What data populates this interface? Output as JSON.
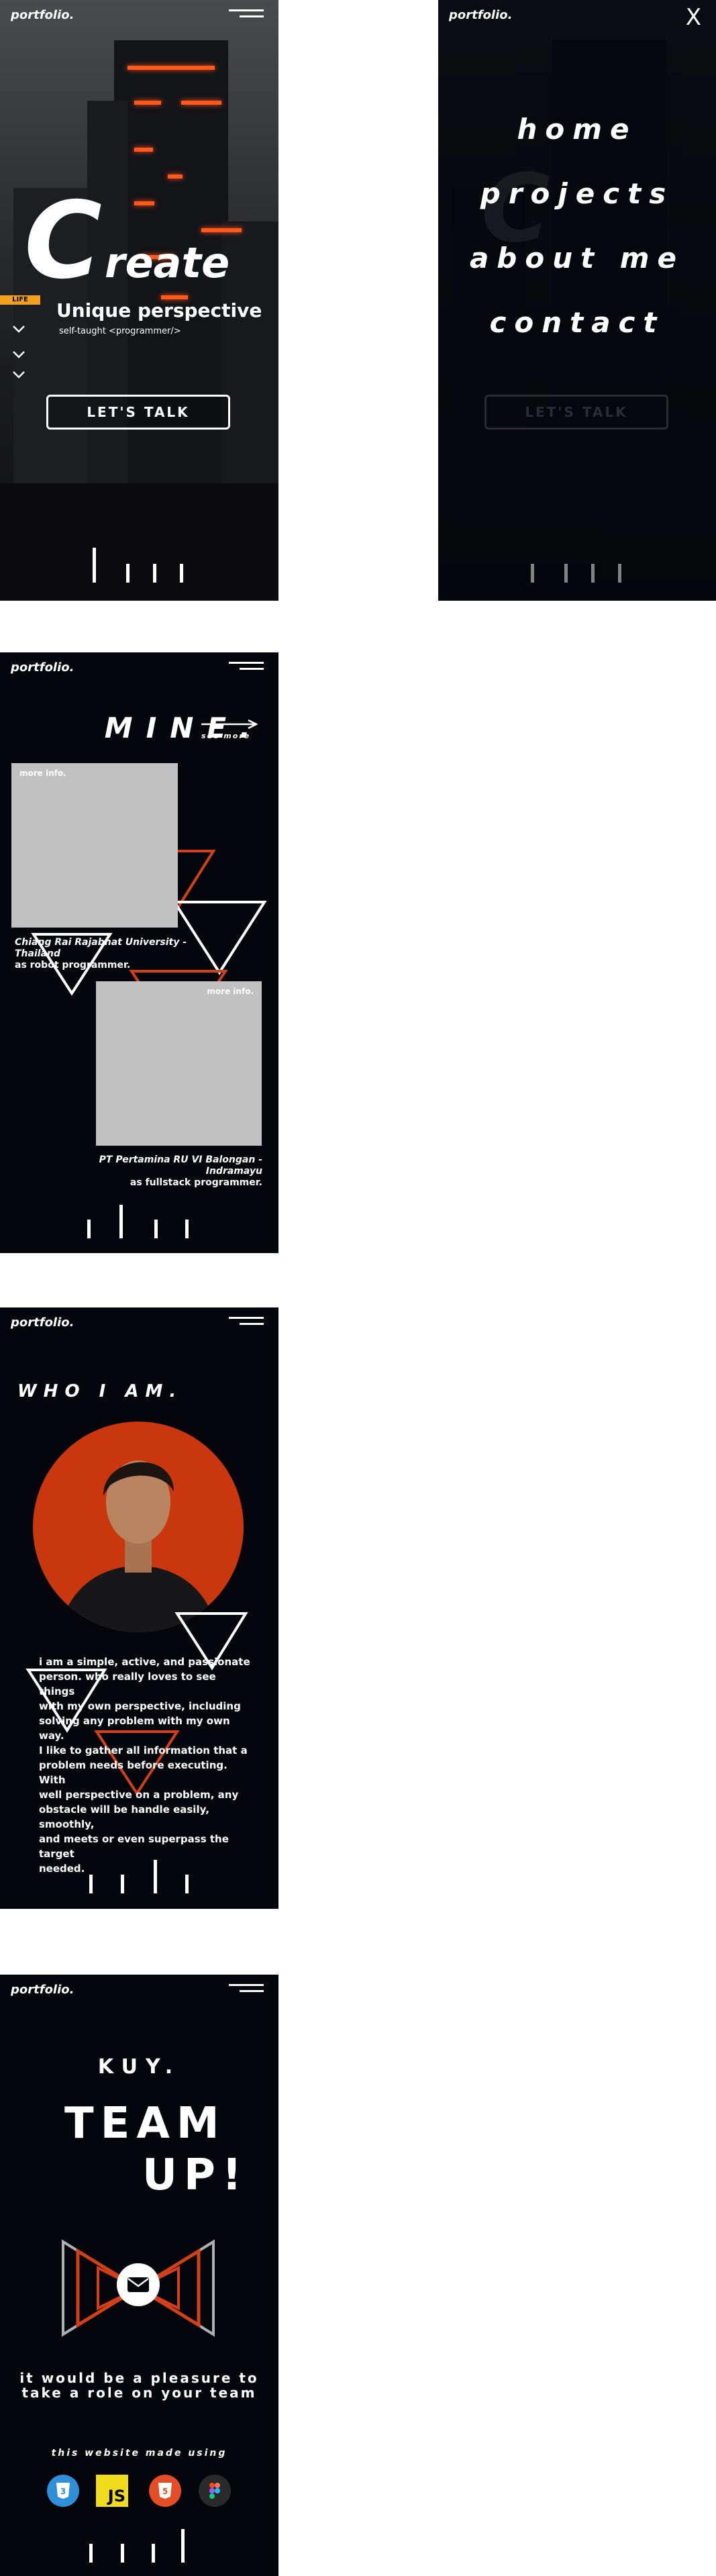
{
  "nav": {
    "logo": "portfolio.",
    "close_symbol": "X"
  },
  "hero": {
    "big_letter": "C",
    "rest_word": "reate",
    "subtitle": "Unique perspective",
    "tagline": "self-taught <programmer/>",
    "cta": "LET'S TALK",
    "sign_text": "LIFE"
  },
  "menu": {
    "items": [
      "home",
      "projects",
      "about me",
      "contact"
    ]
  },
  "projects": {
    "title": "MINE.",
    "see_more": "see more",
    "cards": [
      {
        "more_info": "more info.",
        "caption_lines": [
          "Chiang Rai Rajabhat University -",
          "Thailand",
          "as robot programmer."
        ]
      },
      {
        "more_info": "more info.",
        "caption_lines": [
          "PT Pertamina RU VI Balongan -",
          "Indramayu",
          "as fullstack programmer."
        ]
      }
    ]
  },
  "about": {
    "title": "WHO I AM.",
    "bio_lines": [
      "i am a simple, active, and passionate",
      "person.  who really loves to see things",
      "with my own perspective, including",
      "solving any problem with my own way.",
      "I like to gather all information that a",
      "problem needs before executing. With",
      "well perspective on a problem, any",
      "obstacle will be handle easily, smoothly,",
      "and meets or even superpass the target",
      "needed."
    ]
  },
  "contact": {
    "kuy": "KUY.",
    "team": "TEAM",
    "up": "UP!",
    "pleasure_lines": [
      "it would be a pleasure to",
      "take a role on your team"
    ],
    "made_with": "this website made using",
    "tech": [
      {
        "name": "css3-icon",
        "label": "3",
        "color": "#2f8fd8"
      },
      {
        "name": "javascript-icon",
        "label": "JS",
        "color": "#f0db1d"
      },
      {
        "name": "html5-icon",
        "label": "5",
        "color": "#e44d26"
      },
      {
        "name": "figma-icon",
        "label": "",
        "color": "#2a2a2a"
      }
    ]
  },
  "colors": {
    "background": "#05060b",
    "accent": "#d2401a",
    "card": "#c1c1c1",
    "white": "#ffffff"
  }
}
